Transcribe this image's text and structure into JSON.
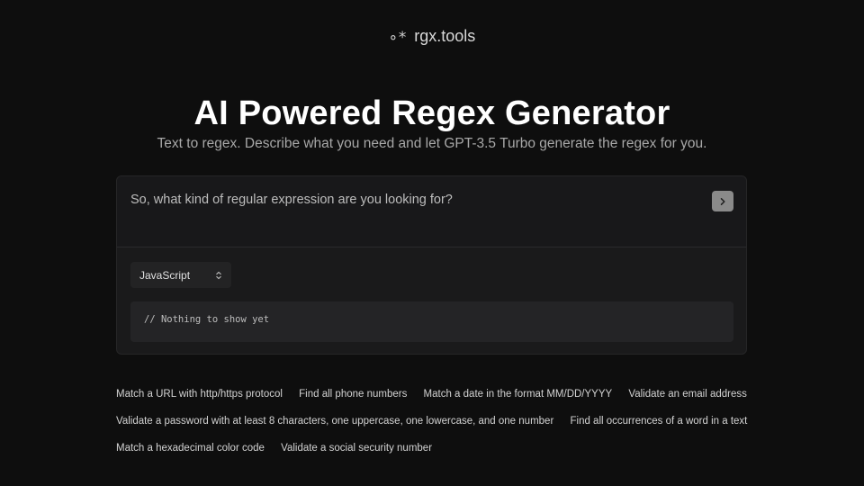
{
  "header": {
    "logo_icon": "regex-star-icon",
    "logo_mark": "∘*",
    "brand": "rgx.tools"
  },
  "hero": {
    "title": "AI Powered Regex Generator",
    "subtitle": "Text to regex. Describe what you need and let GPT-3.5 Turbo generate the regex for you."
  },
  "prompt": {
    "placeholder": "So, what kind of regular expression are you looking for?",
    "submit_icon": "chevron-right-icon"
  },
  "language_select": {
    "selected": "JavaScript",
    "icon": "chevron-up-down-icon"
  },
  "output": {
    "text": "// Nothing to show yet"
  },
  "examples": {
    "rows": [
      [
        "Match a URL with http/https protocol",
        "Find all phone numbers",
        "Match a date in the format MM/DD/YYYY",
        "Validate an email address"
      ],
      [
        "Validate a password with at least 8 characters, one uppercase, one lowercase, and one number",
        "Find all occurrences of a word in a text"
      ],
      [
        "Match a hexadecimal color code",
        "Validate a social security number"
      ]
    ]
  },
  "colors": {
    "background": "#0e0e0e",
    "card": "#1a1a1b",
    "output_box": "#242426",
    "send_button": "#8a8a8a"
  }
}
